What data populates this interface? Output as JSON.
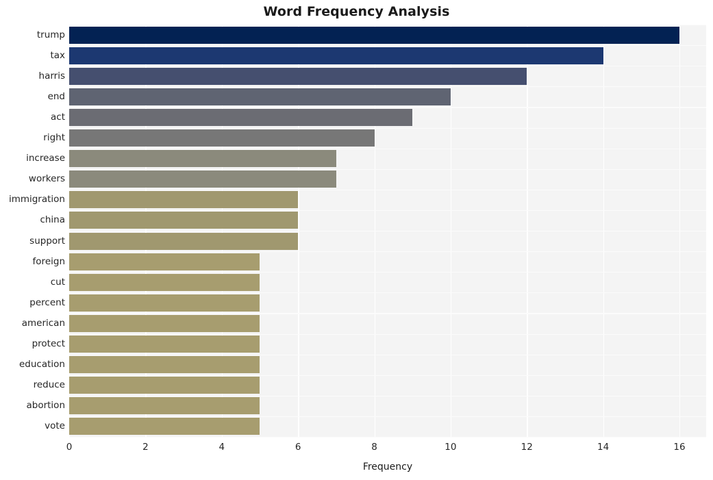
{
  "chart_data": {
    "type": "bar",
    "orientation": "horizontal",
    "title": "Word Frequency Analysis",
    "xlabel": "Frequency",
    "ylabel": "",
    "xlim": [
      0,
      16.7
    ],
    "xticks": [
      0,
      2,
      4,
      6,
      8,
      10,
      12,
      14,
      16
    ],
    "xticklabels": [
      "0",
      "2",
      "4",
      "6",
      "8",
      "10",
      "12",
      "14",
      "16"
    ],
    "grid": true,
    "legend": false,
    "categories": [
      "trump",
      "tax",
      "harris",
      "end",
      "act",
      "right",
      "increase",
      "workers",
      "immigration",
      "china",
      "support",
      "foreign",
      "cut",
      "percent",
      "american",
      "protect",
      "education",
      "reduce",
      "abortion",
      "vote"
    ],
    "values": [
      16,
      14,
      12,
      10,
      9,
      8,
      7,
      7,
      6,
      6,
      6,
      5,
      5,
      5,
      5,
      5,
      5,
      5,
      5,
      5
    ],
    "bar_colors": [
      "#032253",
      "#1c3871",
      "#454f6f",
      "#5f6472",
      "#6b6c73",
      "#777777",
      "#8b8a7c",
      "#8b8a7c",
      "#a0986f",
      "#a0986f",
      "#a0986f",
      "#a79d6f",
      "#a79d6f",
      "#a79d6f",
      "#a79d6f",
      "#a79d6f",
      "#a79d6f",
      "#a79d6f",
      "#a79d6f",
      "#a79d6f"
    ],
    "plot_background": "#f4f4f4",
    "figure_background": "#ffffff",
    "gridline_color": "#ffffff"
  }
}
